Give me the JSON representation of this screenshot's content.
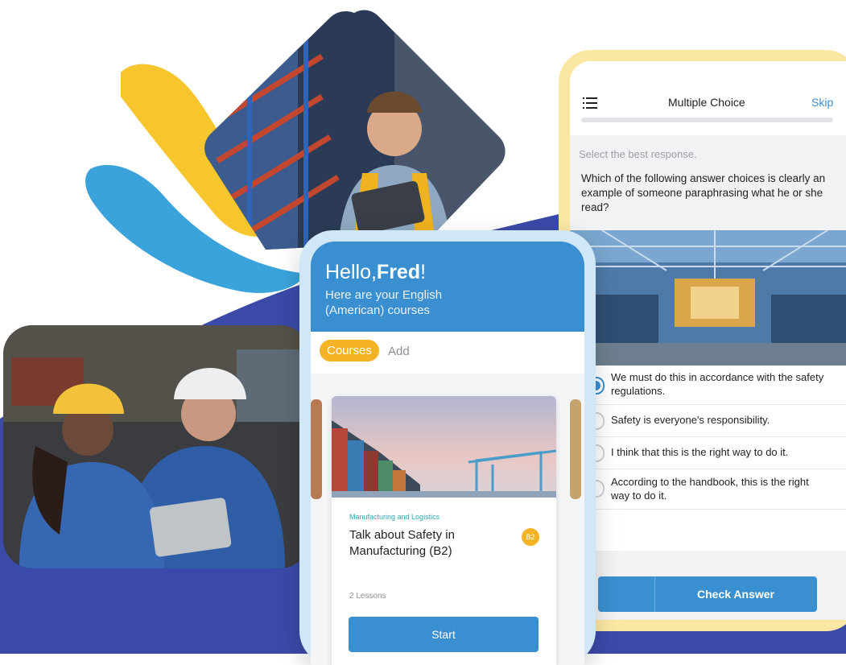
{
  "courses_screen": {
    "greeting_prefix": "Hello,",
    "user_name": "Fred",
    "greeting_suffix": "!",
    "subtitle": "Here are your English (American) courses",
    "tabs": [
      {
        "label": "Courses",
        "active": true
      },
      {
        "label": "Add",
        "active": false
      }
    ],
    "course_card": {
      "category": "Manufacturing and Logistics",
      "title": "Talk about Safety in Manufacturing (B2)",
      "level_badge": "B2",
      "lessons": "2 Lessons",
      "start_label": "Start"
    }
  },
  "quiz_screen": {
    "menu_icon": "list-icon",
    "title": "Multiple Choice",
    "skip_label": "Skip",
    "instruction": "Select the best response.",
    "question": "Which of the following answer choices is clearly an example of someone paraphrasing what he or she read?",
    "options": [
      {
        "text": "We must do this in accordance with the safety regulations.",
        "selected": true
      },
      {
        "text": "Safety is everyone's responsibility.",
        "selected": false
      },
      {
        "text": "I think that this is the right way to do it.",
        "selected": false
      },
      {
        "text": "According to the handbook, this is the right way to do it.",
        "selected": false
      }
    ],
    "check_answer_label": "Check Answer"
  },
  "colors": {
    "brand_blue": "#3a8fd1",
    "accent_yellow": "#f4b324",
    "navy": "#3b4aa8",
    "sky_blue": "#3aa3dc",
    "quiz_frame": "#fbe7a4"
  }
}
